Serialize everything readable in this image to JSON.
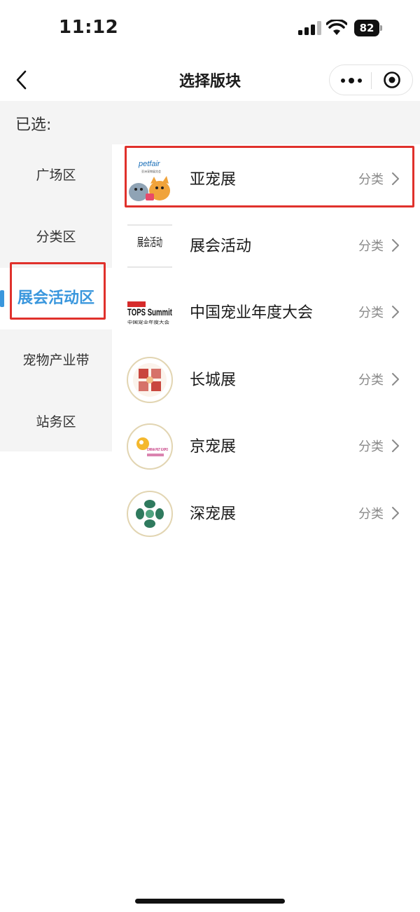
{
  "status_bar": {
    "time": "11:12",
    "battery": "82"
  },
  "nav": {
    "title": "选择版块"
  },
  "selected": {
    "label": "已选:"
  },
  "sidebar": {
    "items": [
      {
        "label": "广场区"
      },
      {
        "label": "分类区"
      },
      {
        "label": "展会活动区",
        "active": true
      },
      {
        "label": "宠物产业带"
      },
      {
        "label": "站务区"
      }
    ]
  },
  "list": {
    "items": [
      {
        "title": "亚宠展",
        "action": "分类",
        "logo_text": "petfair",
        "logo_sub": "亚洲宠物展览会"
      },
      {
        "title": "展会活动",
        "action": "分类",
        "logo_text": "展会活动"
      },
      {
        "title": "中国宠业年度大会",
        "action": "分类",
        "logo_text": "TOPS Summit",
        "logo_sub": "中国宠业年度大会"
      },
      {
        "title": "长城展",
        "action": "分类"
      },
      {
        "title": "京宠展",
        "action": "分类",
        "logo_text": "CHINA PET EXPO"
      },
      {
        "title": "深宠展",
        "action": "分类"
      }
    ]
  },
  "colors": {
    "accent": "#3a97dd",
    "highlight_box": "#e0312c"
  }
}
